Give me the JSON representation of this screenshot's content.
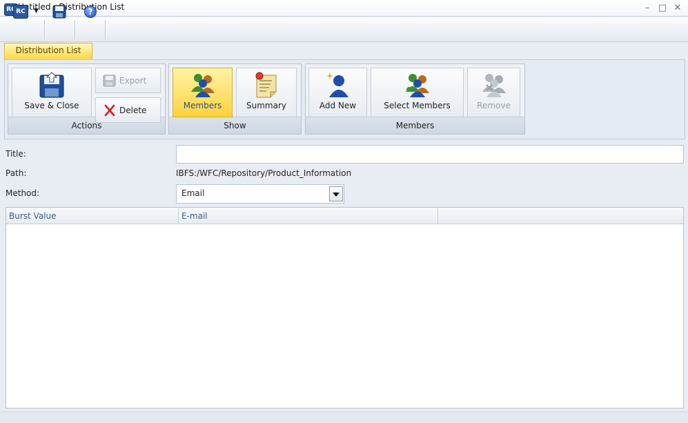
{
  "window": {
    "title": "Untitled - Distribution List",
    "logo_text": "RC",
    "controls": [
      "minimize",
      "maximize",
      "close"
    ]
  },
  "quick_access": {
    "logo_text": "RC",
    "dropdown_icon": "caret-down-icon",
    "save_icon": "floppy-disk-icon",
    "help_icon": "help-icon",
    "help_text": "?"
  },
  "ribbon": {
    "active_tab": "Distribution List",
    "groups": {
      "actions": {
        "label": "Actions",
        "save_close": "Save & Close",
        "export": "Export",
        "delete": "Delete"
      },
      "show": {
        "label": "Show",
        "members": "Members",
        "summary": "Summary"
      },
      "members": {
        "label": "Members",
        "add_new": "Add New",
        "select_members": "Select Members",
        "remove": "Remove"
      }
    }
  },
  "form": {
    "title_label": "Title:",
    "title_value": "",
    "path_label": "Path:",
    "path_value": "IBFS:/WFC/Repository/Product_Information",
    "method_label": "Method:",
    "method_value": "Email"
  },
  "grid": {
    "columns": [
      "Burst Value",
      "E-mail"
    ],
    "rows": []
  },
  "colors": {
    "accent_yellow": "#ffd94a",
    "ribbon_bg": "#e5ebf2",
    "header_text": "#3b5a82"
  }
}
